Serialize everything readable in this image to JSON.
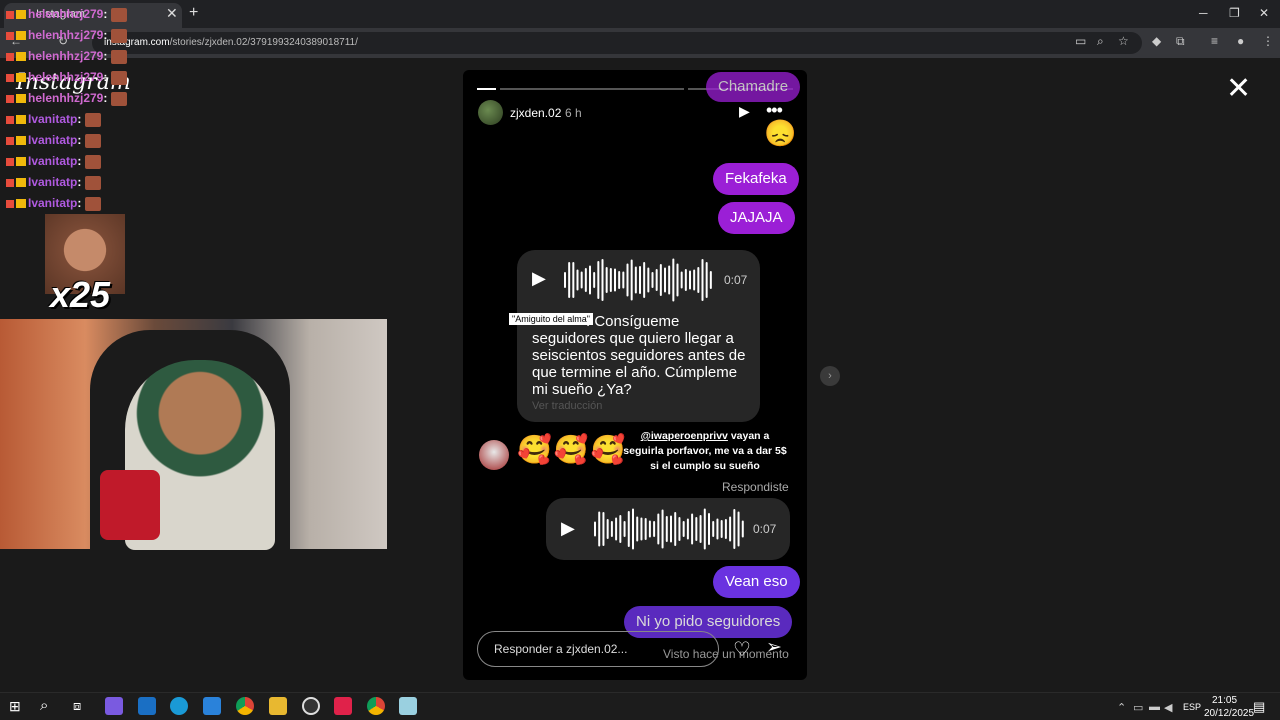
{
  "browser": {
    "tab_title": "Instagram",
    "url_domain": "instagram.com",
    "url_path": "/stories/zjxden.02/3791993240389018711/"
  },
  "instagram": {
    "logo": "Instagram",
    "story": {
      "username": "zjxden.02",
      "time_ago": "6 h",
      "messages": {
        "chamadre": "Chamadre",
        "sad_emoji": "😞",
        "fekafeka": "Fekafeka",
        "jajaja": "JAJAJA",
        "voice1_duration": "0:07",
        "caption_tag": "\"Amiguito del alma\"",
        "caption": ". Consígueme seguidores que quiero llegar a seiscientos seguidores antes de que termine el año. Cúmpleme mi sueño ¿Ya?",
        "voice1_sub": "Ver traducción",
        "reply_emojis": "🥰🥰🥰",
        "reply_mention": "@iwaperoenprivv",
        "reply_text": " vayan a seguirla porfavor, me va a dar 5$ si el cumplo su sueño",
        "replied_label": "Respondiste",
        "voice2_duration": "0:07",
        "vean_eso": "Vean eso",
        "ni_yo_pido": "Ni yo pido seguidores"
      },
      "reply_placeholder": "Responder a zjxden.02...",
      "seen_label": "Visto hace un momento"
    }
  },
  "stream_chat": [
    {
      "user": "helenhhzj279",
      "sep": ":"
    },
    {
      "user": "helenhhzj279",
      "sep": ":"
    },
    {
      "user": "helenhhzj279",
      "sep": ":"
    },
    {
      "user": "helenhhzj279",
      "sep": ":"
    },
    {
      "user": "helenhhzj279",
      "sep": ":"
    },
    {
      "user": "Ivanitatp",
      "sep": ":"
    },
    {
      "user": "Ivanitatp",
      "sep": ":"
    },
    {
      "user": "Ivanitatp",
      "sep": ":"
    },
    {
      "user": "Ivanitatp",
      "sep": ":"
    },
    {
      "user": "Ivanitatp",
      "sep": ":"
    }
  ],
  "emote_count": "x25",
  "taskbar": {
    "time": "21:05",
    "date": "20/12/2025",
    "lang": "ESP"
  }
}
